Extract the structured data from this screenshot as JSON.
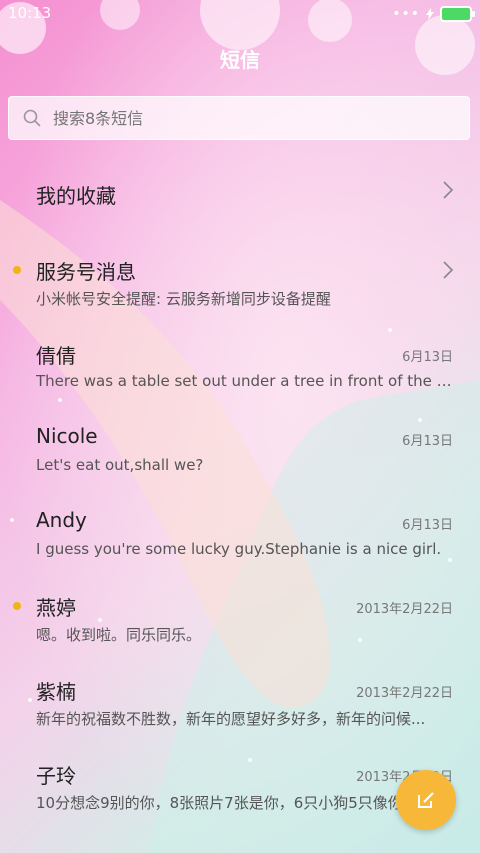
{
  "status_bar": {
    "time": "10:13"
  },
  "header": {
    "title": "短信"
  },
  "search": {
    "placeholder": "搜索8条短信"
  },
  "conversations": [
    {
      "name": "我的收藏",
      "preview": "",
      "date": "",
      "has_chevron": true,
      "unread": false
    },
    {
      "name": "服务号消息",
      "preview": "小米帐号安全提醒: 云服务新增同步设备提醒",
      "date": "",
      "has_chevron": true,
      "unread": true
    },
    {
      "name": "倩倩",
      "preview": "There was a table set out under a tree in front of the ho...",
      "date": "6月13日",
      "unread": false
    },
    {
      "name": "Nicole",
      "preview": "Let's eat out,shall we?",
      "date": "6月13日",
      "unread": false
    },
    {
      "name": "Andy",
      "preview": "I guess you're some lucky guy.Stephanie is a nice girl.",
      "date": "6月13日",
      "unread": false
    },
    {
      "name": "燕婷",
      "preview": "嗯。收到啦。同乐同乐。",
      "date": "2013年2月22日",
      "unread": true
    },
    {
      "name": "紫楠",
      "preview": "新年的祝福数不胜数，新年的愿望好多好多，新年的问候...",
      "date": "2013年2月22日",
      "unread": false
    },
    {
      "name": "子玲",
      "preview": "10分想念9别的你，8张照片7张是你，6只小狗5只像你",
      "date": "2013年2月22日",
      "unread": false
    }
  ],
  "colors": {
    "unread_dot": "#f0b414",
    "fab": "#f7b83a"
  },
  "icons": {
    "search": "search-icon",
    "chevron": "chevron-right-icon",
    "compose": "compose-icon"
  }
}
